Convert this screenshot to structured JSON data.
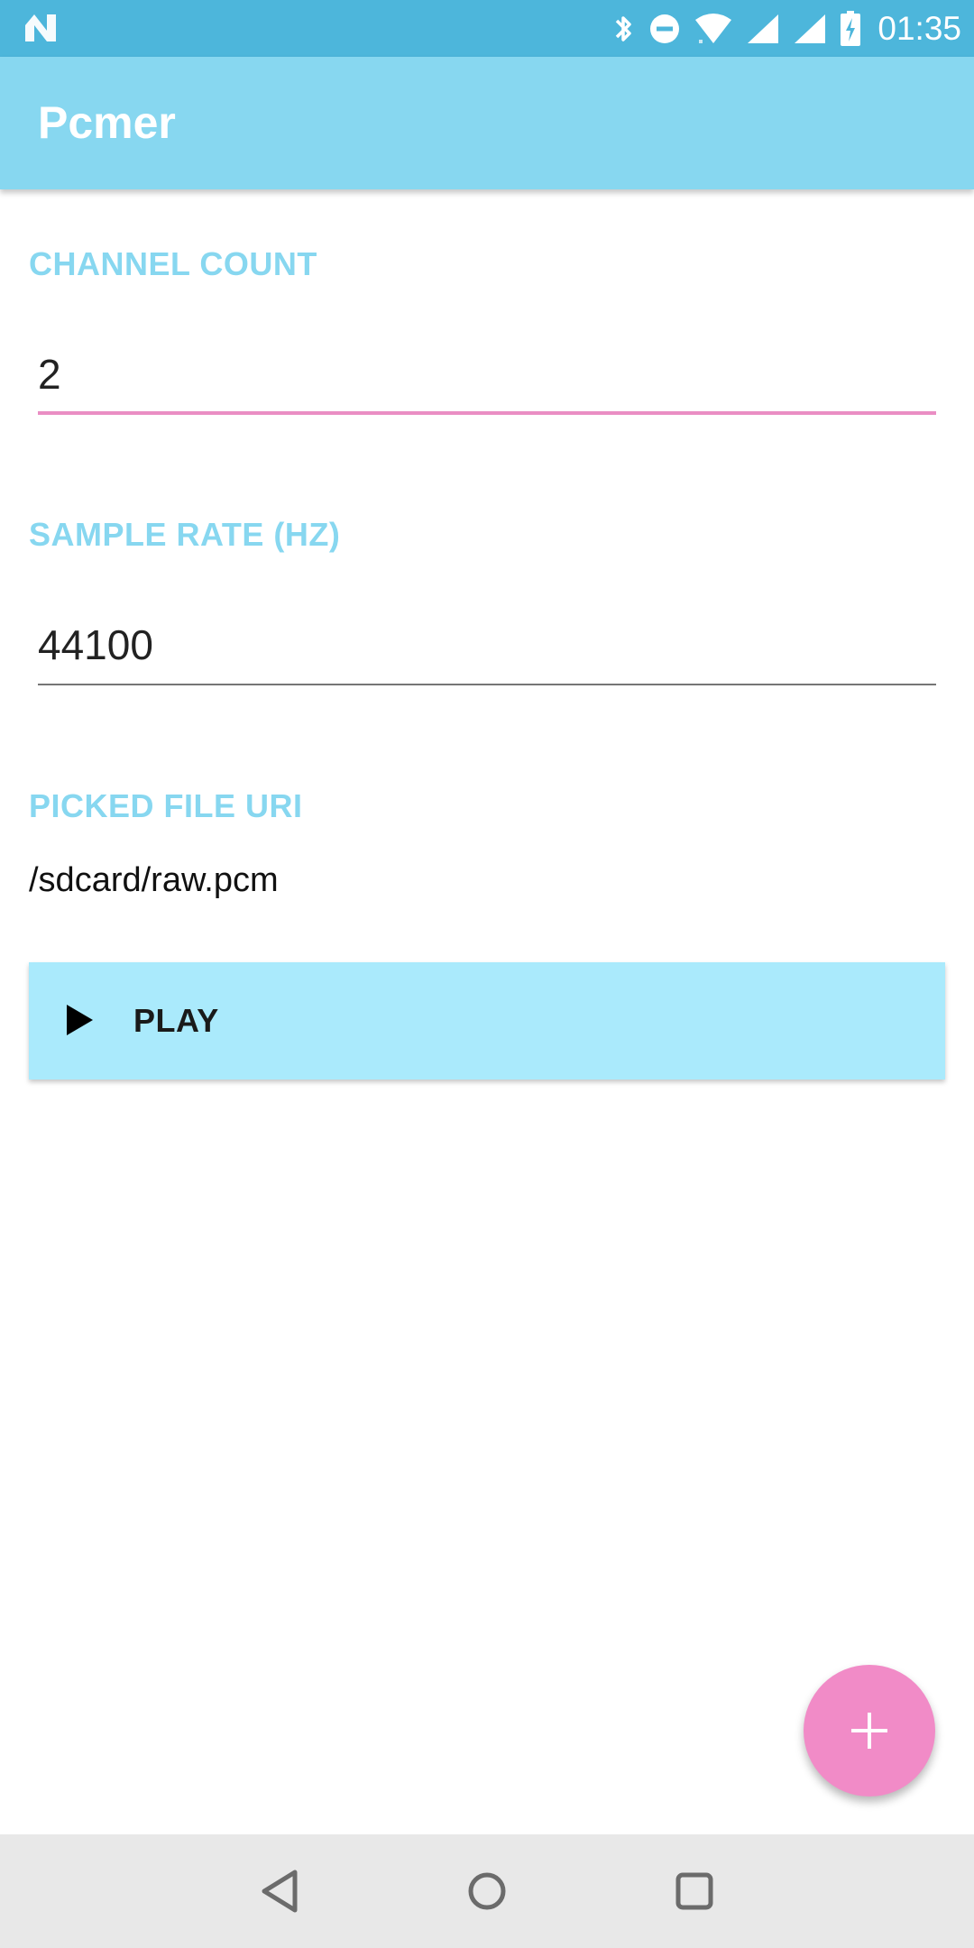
{
  "status_bar": {
    "time": "01:35",
    "icons": [
      "notification-n-icon",
      "bluetooth-icon",
      "do-not-disturb-icon",
      "wifi-icon",
      "signal-icon",
      "signal-icon",
      "battery-charging-icon"
    ]
  },
  "app_bar": {
    "title": "Pcmer"
  },
  "form": {
    "channel_count": {
      "label": "CHANNEL COUNT",
      "value": "2"
    },
    "sample_rate": {
      "label": "SAMPLE RATE (HZ)",
      "value": "44100"
    },
    "picked_file": {
      "label": "PICKED FILE URI",
      "value": "/sdcard/raw.pcm"
    },
    "play_button": {
      "label": "PLAY",
      "icon": "play-icon"
    }
  },
  "fab": {
    "icon": "plus-icon"
  },
  "nav_bar": {
    "icons": [
      "back-icon",
      "home-icon",
      "recents-icon"
    ]
  },
  "colors": {
    "status_bar": "#4db6db",
    "app_bar": "#87d7f0",
    "label": "#87d7f0",
    "focused_underline": "#ea8ec4",
    "play_button": "#aaeafc",
    "fab": "#f18bc7",
    "nav_bar": "#e8e8e8"
  }
}
